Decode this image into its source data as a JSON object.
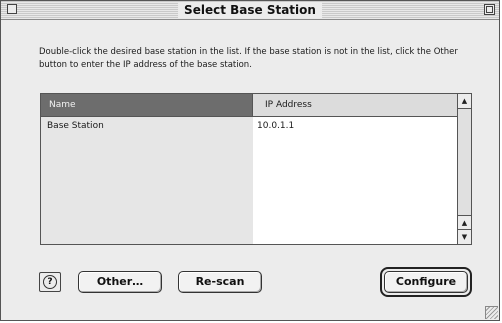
{
  "window": {
    "title": "Select Base Station"
  },
  "instructions": "Double-click the desired base station in the list. If the base station is not in the list, click the Other button to enter the IP address of the base station.",
  "list": {
    "columns": [
      "Name",
      "IP Address"
    ],
    "rows": [
      {
        "name": "Base Station",
        "ip": "10.0.1.1"
      }
    ]
  },
  "buttons": {
    "help": "?",
    "other": "Other…",
    "rescan": "Re-scan",
    "configure": "Configure"
  },
  "scrollbar": {
    "up_arrow": "▲",
    "down_arrow": "▼"
  }
}
